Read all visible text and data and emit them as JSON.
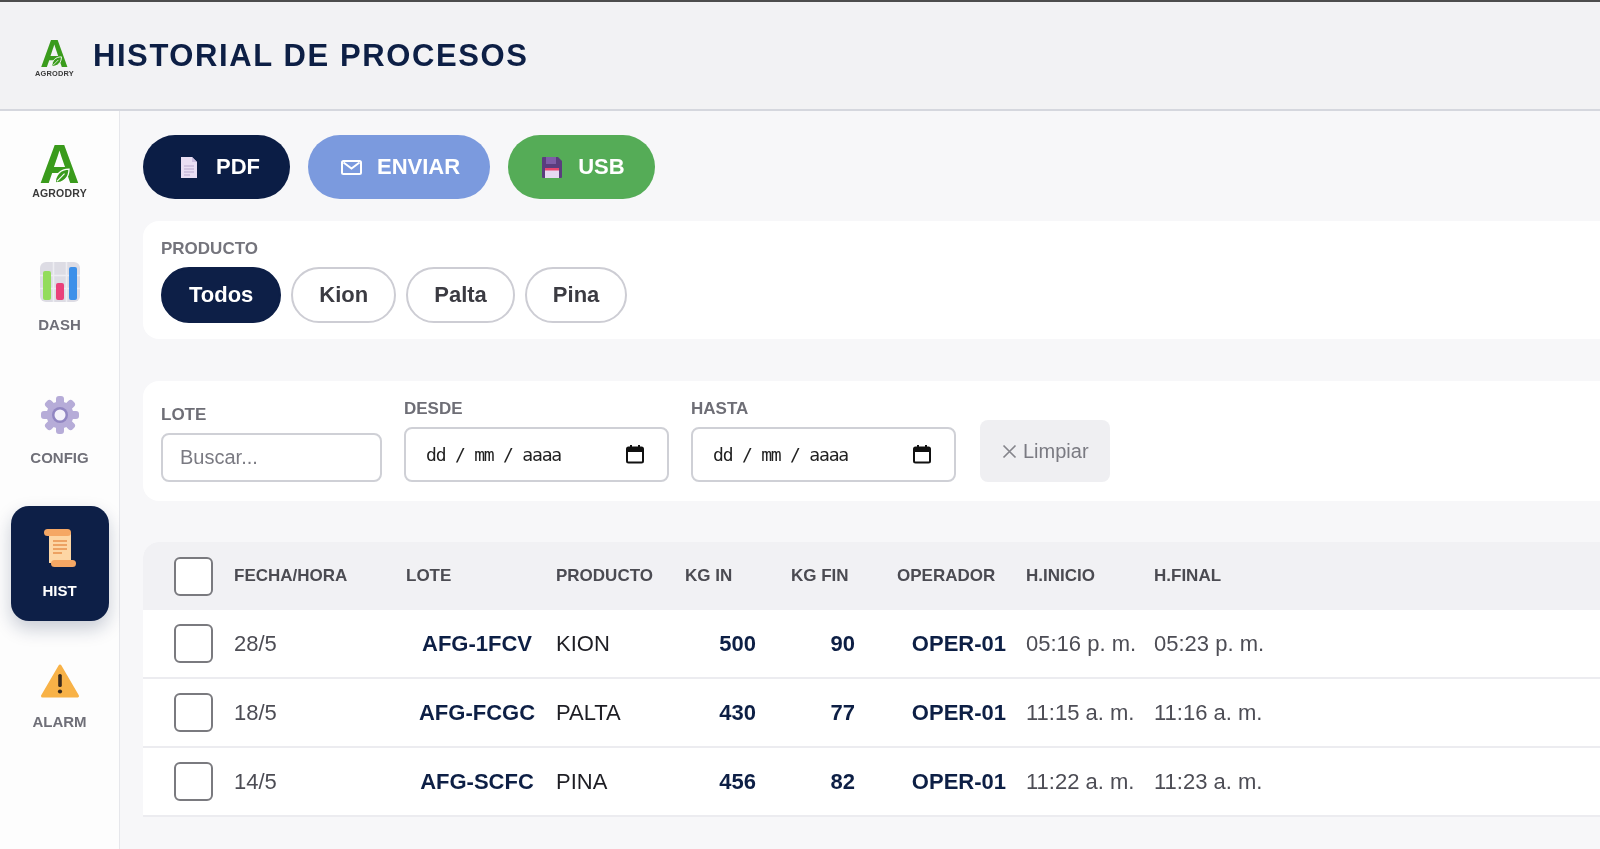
{
  "header": {
    "logo": {
      "mark": "A",
      "name": "AGRODRY"
    },
    "title": "HISTORIAL DE PROCESOS"
  },
  "sidebar": {
    "logo": {
      "mark": "A",
      "name": "AGRODRY"
    },
    "items": [
      {
        "kind": "dashboard",
        "label": "DASH",
        "selected": false
      },
      {
        "kind": "settings",
        "label": "CONFIG",
        "selected": false
      },
      {
        "kind": "history",
        "label": "HIST",
        "selected": true
      },
      {
        "kind": "alarm",
        "label": "ALARM",
        "selected": false
      }
    ]
  },
  "actions": [
    {
      "kind": "pdf",
      "label": "PDF"
    },
    {
      "kind": "send",
      "label": "ENVIAR"
    },
    {
      "kind": "usb",
      "label": "USB"
    }
  ],
  "product_filter": {
    "label": "PRODUCTO",
    "options": [
      {
        "label": "Todos",
        "selected": true
      },
      {
        "label": "Kion",
        "selected": false
      },
      {
        "label": "Palta",
        "selected": false
      },
      {
        "label": "Pina",
        "selected": false
      }
    ]
  },
  "filters": {
    "batch_search": {
      "label": "LOTE",
      "placeholder": "Buscar..."
    },
    "date_from": {
      "label": "DESDE",
      "placeholder": "dd / mm / aaaa"
    },
    "date_to": {
      "label": "HASTA",
      "placeholder": "dd / mm / aaaa"
    },
    "clear_button": {
      "label": "Limpiar"
    }
  },
  "table": {
    "select_all": {
      "checked": false
    },
    "columns": [
      "FECHA/HORA",
      "LOTE",
      "PRODUCTO",
      "KG IN",
      "KG FIN",
      "OPERADOR",
      "H.INICIO",
      "H.FINAL"
    ],
    "rows": [
      {
        "checked": false,
        "cells": [
          "28/5",
          "AFG-1FCV",
          "KION",
          "500",
          "90",
          "OPER-01",
          "05:16 p. m.",
          "05:23 p. m."
        ]
      },
      {
        "checked": false,
        "cells": [
          "18/5",
          "AFG-FCGC",
          "PALTA",
          "430",
          "77",
          "OPER-01",
          "11:15 a. m.",
          "11:16 a. m."
        ]
      },
      {
        "checked": false,
        "cells": [
          "14/5",
          "AFG-SCFC",
          "PINA",
          "456",
          "82",
          "OPER-01",
          "11:22 a. m.",
          "11:23 a. m."
        ]
      }
    ]
  }
}
